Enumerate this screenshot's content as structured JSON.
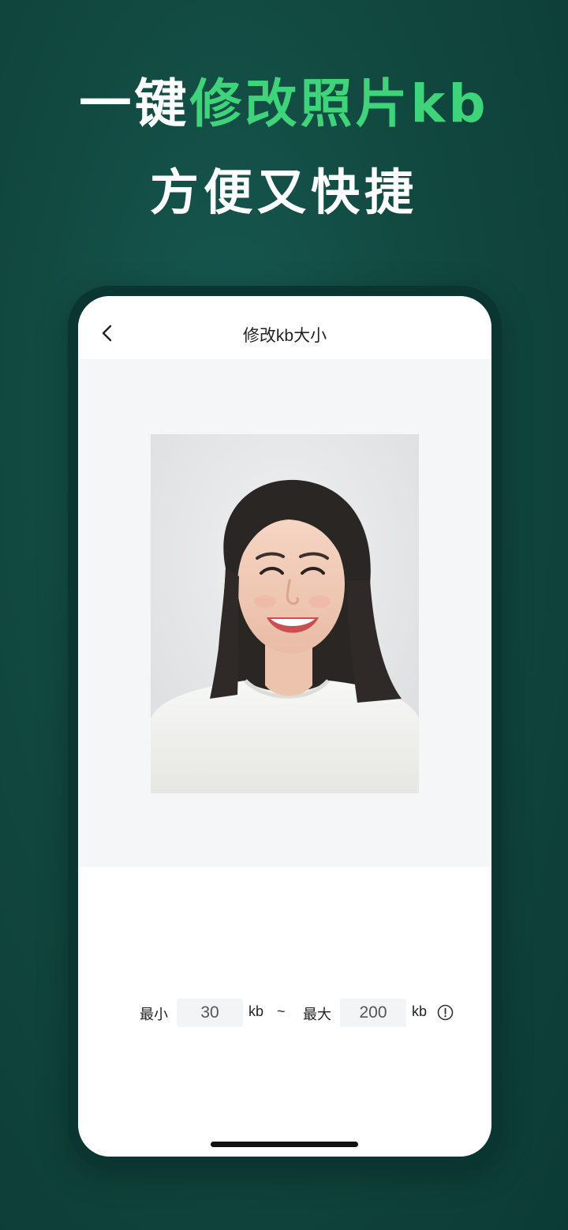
{
  "headline": {
    "line1_plain": "一键",
    "line1_accent": "修改照片kb",
    "line2": "方便又快捷"
  },
  "colors": {
    "background": "#11483f",
    "accent": "#3fd37a",
    "phone_frame": "#0b3530"
  },
  "nav": {
    "title": "修改kb大小",
    "back_icon": "chevron-left-icon"
  },
  "photo": {
    "subject": "portrait-photo"
  },
  "size_range": {
    "min_label": "最小",
    "min_value": "30",
    "min_unit": "kb",
    "separator": "~",
    "max_label": "最大",
    "max_value": "200",
    "max_unit": "kb",
    "info_icon": "info-circle-icon"
  }
}
